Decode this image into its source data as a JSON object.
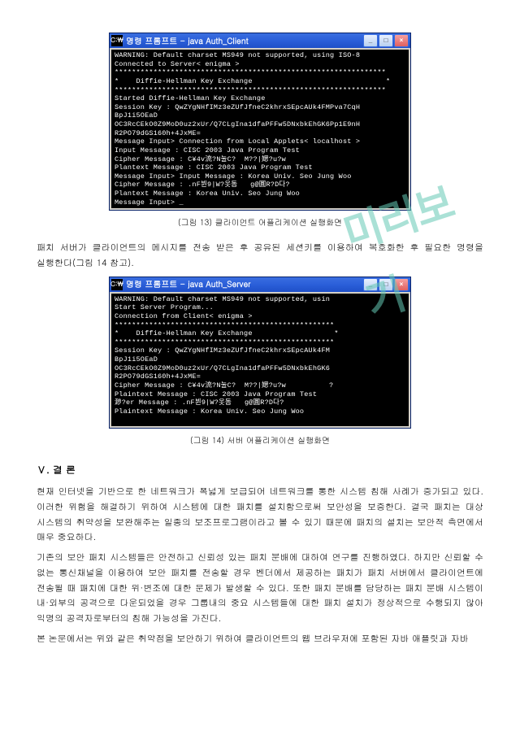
{
  "watermark": "미리보기",
  "window1": {
    "title": "명령 프롬프트 - java Auth_Client",
    "lines": [
      "WARNING: Default charset MS949 not supported, using ISO-8",
      "Connected to Server< enigma >",
      "***************************************************************",
      "*    Diffie-Hellman Key Exchange                               *",
      "***************************************************************",
      "Started Diffie-Hellman Key Exchange",
      "Session Key : QwZYgNHfIMz3eZUfJfneC2khrxSEpcAUk4FMPva7CqH",
      "BpJ1i5OEaD",
      "OC3RcCEkO0Z9MoD0uz2xUr/Q7CLgIna1dfaPFFw5DNxbkEhGK6Pp1E9nH",
      "R2PO79dGS160h+4JxME=",
      "Message Input> Connection from Local Applets< localhost >",
      "Input Message : CISC 2003 Java Program Test",
      "Cipher Message : C¥4v流?N눌C?  M??|媤?u?w",
      "Plantext Message : CISC 2003 Java Program Test",
      "Message Input> Input Message : Korea Univ. Seo Jung Woo",
      "Cipher Message : .nF뷘9|W?옷돔   g@圓R?D다?",
      "Plantext Message : Korea Univ. Seo Jung Woo",
      "Message Input> _"
    ]
  },
  "caption1": "(그림 13) 클라이언트 어플리케이션 실행화면",
  "para1": "패치 서버가 클라이언트의 메시지를 전송 받은 후 공유된 세션키를 이용하여 복호화한 후 필요한 명령을 실행한다(그림 14 참고).",
  "window2": {
    "title": "명령 프롬프트 - java Auth_Server",
    "lines": [
      "WARNING: Default charset MS949 not supported, usin",
      "Start Server Program...",
      "Connection from Client< enigma >",
      "***************************************************",
      "*    Diffie-Hellman Key Exchange                   *",
      "***************************************************",
      "Session Key : QwZYgNHfIMz3eZUfJfneC2khrxSEpcAUk4FM",
      "BpJ1i5OEaD",
      "OC3RcCEkO0Z9MoD0uz2xUr/Q7CLgIna1dfaPFFw5DNxbkEhGK6",
      "R2PO79dGS160h+4JxME=",
      "Cipher Message : C¥4v流?N눌C?  M??|媤?u?w          ?",
      "Plaintext Message : CISC 2003 Java Program Test",
      "渺?er Message : .nF뷘9|W?옷돔   g@圓R?D다?",
      "Plaintext Message : Korea Univ. Seo Jung Woo",
      "",
      ""
    ]
  },
  "caption2": "(그림 14) 서버 어플리케이션 실행화면",
  "section_heading": "Ⅴ. 결 론",
  "para2": "현재 인터넷을 기반으로 한 네트워크가 폭넓게 보급되어 네트워크를 통한 시스템 침해 사례가 증가되고 있다. 이러한 위험을 해결하기 위하여 시스템에 대한 패치를 설치함으로써 보안성을 보증한다. 결국 패치는 대상 시스템의 취약성을 보완해주는 일종의 보조프로그램이라고 볼 수 있기 때문에 패치의 설치는 보안적 측면에서 매우 중요하다.",
  "para3": "기존의 보안 패치 시스템들은 안전하고 신뢰성 있는 패치 분배에 대하여 연구를 진행하였다. 하지만 신뢰할 수 없는 통신채널을 이용하여 보안 패치를 전송할 경우 벤더에서 제공하는 패치가 패치 서버에서 클라이언트에 전송될 때 패치에 대한 위·변조에 대한 문제가 발생할 수 있다. 또한 패치 분배를 담당하는 패치 분배 시스템이 내·외부의 공격으로 다운되었을 경우 그룹내의 중요 시스템들에 대한 패치 설치가 정상적으로 수행되지 않아 익명의 공격자로부터의 침해 가능성을 가진다.",
  "para4": "본 논문에서는 위와 같은 취약점을 보안하기 위하여 클라이언트의 웹 브라우저에 포함된 자바 애플릿과 자바",
  "ui": {
    "minimize": "_",
    "maximize": "□",
    "close": "×",
    "icon_glyph": "C:\\"
  }
}
